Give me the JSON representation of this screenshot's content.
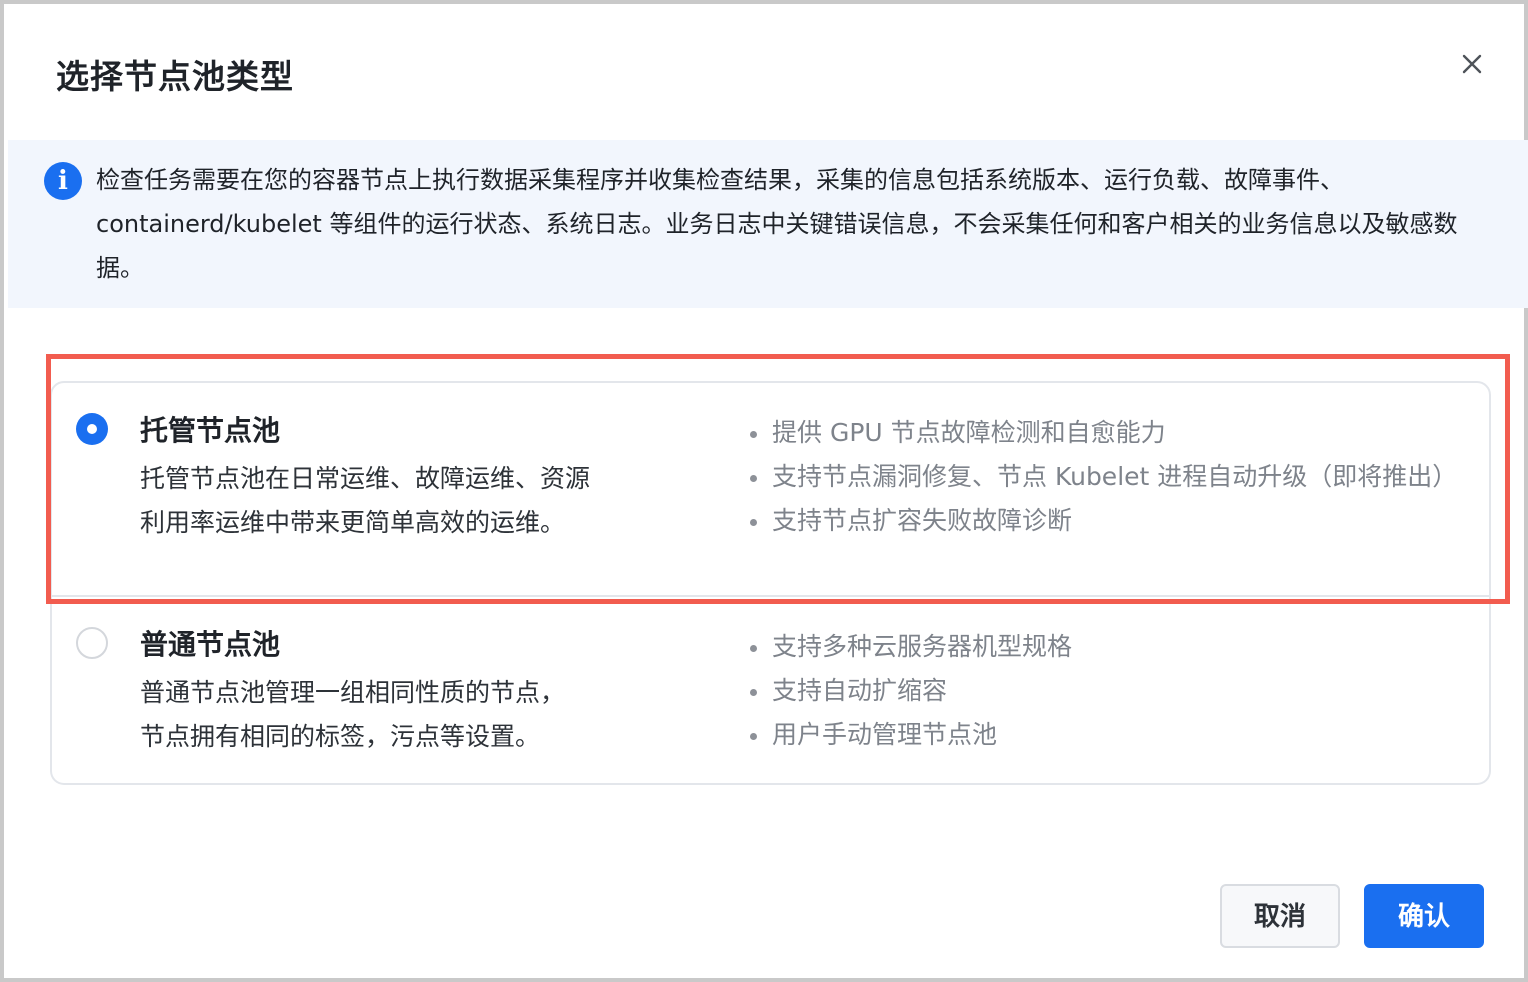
{
  "dialog": {
    "title": "选择节点池类型",
    "close_icon": "close-icon"
  },
  "notice": {
    "icon": "info-icon",
    "text": "检查任务需要在您的容器节点上执行数据采集程序并收集检查结果，采集的信息包括系统版本、运行负载、故障事件、containerd/kubelet 等组件的运行状态、系统日志。业务日志中关键错误信息，不会采集任何和客户相关的业务信息以及敏感数据。"
  },
  "options": [
    {
      "title": "托管节点池",
      "selected": true,
      "desc_lines": [
        "托管节点池在日常运维、故障运维、资源",
        "利用率运维中带来更简单高效的运维。"
      ],
      "features": [
        "提供 GPU 节点故障检测和自愈能力",
        "支持节点漏洞修复、节点 Kubelet 进程自动升级（即将推出）",
        "支持节点扩容失败故障诊断"
      ]
    },
    {
      "title": "普通节点池",
      "selected": false,
      "desc_lines": [
        "普通节点池管理一组相同性质的节点，",
        "节点拥有相同的标签，污点等设置。"
      ],
      "features": [
        "支持多种云服务器机型规格",
        "支持自动扩缩容",
        "用户手动管理节点池"
      ]
    }
  ],
  "footer": {
    "cancel_label": "取消",
    "confirm_label": "确认"
  },
  "colors": {
    "accent": "#1a6ff0",
    "highlight": "#f25c4f",
    "notice_bg": "#f2f6fd"
  }
}
